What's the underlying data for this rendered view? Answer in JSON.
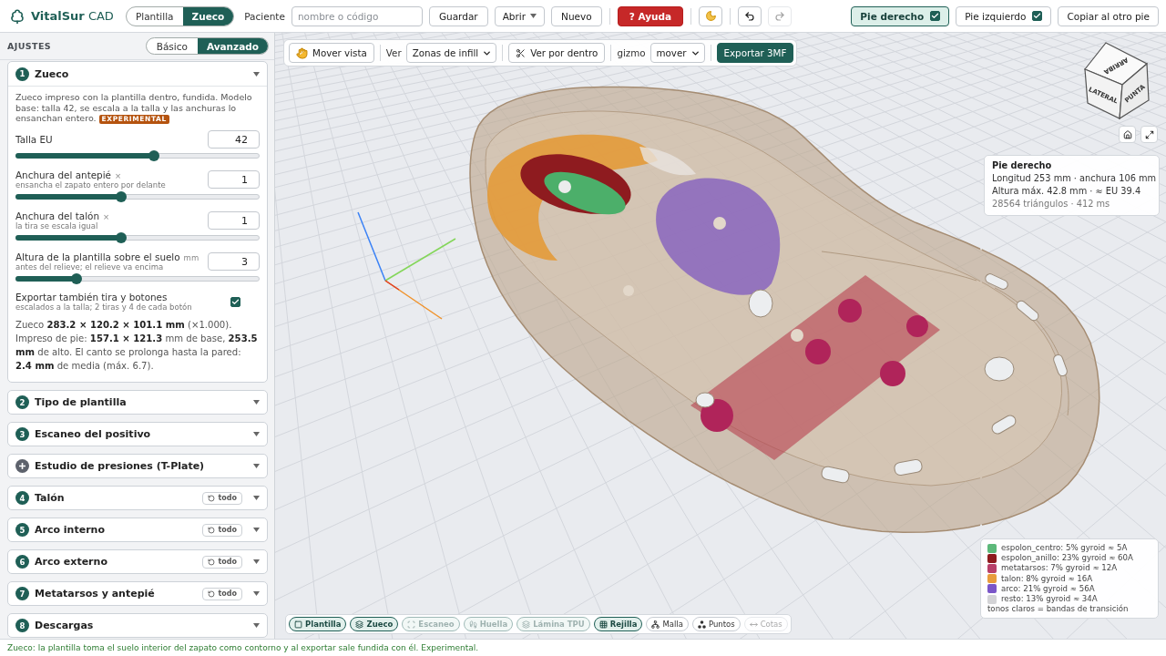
{
  "app_title": "**VitalSur** CAD",
  "mode_tabs": [
    {
      "label": "Plantilla",
      "selected": false
    },
    {
      "label": "Zueco",
      "selected": true
    }
  ],
  "patient": {
    "label": "Paciente",
    "placeholder": "nombre o código"
  },
  "file_buttons": [
    {
      "label": "Guardar",
      "kind": "plain"
    },
    {
      "label": "Abrir",
      "kind": "menu"
    },
    {
      "label": "Nuevo",
      "kind": "plain"
    }
  ],
  "help_button": "? Ayuda",
  "history": [
    {
      "disabled": false
    },
    {
      "disabled": true
    }
  ],
  "feet": [
    {
      "label": "Pie derecho",
      "selected": true,
      "checked": true
    },
    {
      "label": "Pie izquierdo",
      "selected": false,
      "checked": true
    }
  ],
  "copy_button": "Copiar al otro pie",
  "sidebar": {
    "title": "AJUSTES",
    "modes": [
      {
        "label": "Básico",
        "selected": false
      },
      {
        "label": "Avanzado",
        "selected": true
      }
    ],
    "sections": [
      {
        "kind": "numbered",
        "number": "1",
        "title": "Zueco",
        "expanded": true,
        "description": "Zueco impreso con la plantilla dentro, fundida. Modelo base: talla 42, se escala a la talla y las anchuras lo ensanchan entero.",
        "badge": "EXPERIMENTAL",
        "controls": [
          {
            "kind": "slider",
            "label": "Talla EU",
            "value": "42",
            "level": 0.57
          },
          {
            "kind": "slider",
            "label": "Anchura del antepié",
            "unit": "×",
            "hint": "ensancha el zapato entero por delante",
            "value": "1",
            "level": 0.43
          },
          {
            "kind": "slider",
            "label": "Anchura del talón",
            "unit": "×",
            "hint": "la tira se escala igual",
            "value": "1",
            "level": 0.43
          },
          {
            "kind": "slider",
            "label": "Altura de la plantilla sobre el suelo",
            "unit": "mm",
            "hint": "antes del relieve; el relieve va encima",
            "value": "3",
            "level": 0.24
          },
          {
            "kind": "checkbox",
            "label": "Exportar también tira y botones",
            "hint": "escalados a la talla; 2 tiras y 4 de cada botón",
            "checked": true
          }
        ],
        "summary": "Zueco **283.2 × 120.2 × 101.1 mm** (×1.000). Impreso de pie: **157.1 × 121.3** mm de base, **253.5 mm** de alto. El canto se prolonga hasta la pared: **2.4 mm** de media (máx. 6.7)."
      },
      {
        "kind": "numbered",
        "number": "2",
        "title": "Tipo de plantilla",
        "expanded": false
      },
      {
        "kind": "numbered",
        "number": "3",
        "title": "Escaneo del positivo",
        "expanded": false
      },
      {
        "kind": "optional",
        "title": "Estudio de presiones (T-Plate)",
        "expanded": false
      },
      {
        "kind": "numbered",
        "number": "4",
        "title": "Talón",
        "expanded": false,
        "reset": "todo"
      },
      {
        "kind": "numbered",
        "number": "5",
        "title": "Arco interno",
        "expanded": false,
        "reset": "todo"
      },
      {
        "kind": "numbered",
        "number": "6",
        "title": "Arco externo",
        "expanded": false,
        "reset": "todo"
      },
      {
        "kind": "numbered",
        "number": "7",
        "title": "Metatarsos y antepié",
        "expanded": false,
        "reset": "todo"
      },
      {
        "kind": "numbered",
        "number": "8",
        "title": "Descargas",
        "expanded": false
      }
    ]
  },
  "viewport": {
    "toolbar": {
      "pan_button": "Mover vista",
      "view_label": "Ver",
      "view_select": "Zonas de infill",
      "section_button": "Ver por dentro",
      "gizmo_label": "gizmo",
      "gizmo_select": "mover",
      "export_button": "Exportar 3MF"
    },
    "view_cube": {
      "faces": [
        "ARRIBA",
        "LATERAL",
        "PUNTA"
      ]
    },
    "info": {
      "title": "Pie derecho",
      "lines": [
        "Longitud 253 mm · anchura 106 mm",
        "Altura máx. 42.8 mm · ≈ EU 39.4"
      ],
      "meta": "28564 triángulos · 412 ms"
    },
    "legend": {
      "items": [
        {
          "label": "espolon_centro: 5% gyroid ≈ 5A",
          "color": "#5cb87a"
        },
        {
          "label": "espolon_anillo: 23% gyroid ≈ 60A",
          "color": "#8e1b1f"
        },
        {
          "label": "metatarsos: 7% gyroid ≈ 12A",
          "color": "#b8406a"
        },
        {
          "label": "talon: 8% gyroid ≈ 16A",
          "color": "#e89c3c"
        },
        {
          "label": "arco: 21% gyroid ≈ 56A",
          "color": "#7a56c8"
        },
        {
          "label": "resto: 13% gyroid ≈ 34A",
          "color": "#d3d3d6"
        }
      ],
      "note": "tonos claros = bandas de transición"
    },
    "layers": [
      {
        "label": "Plantilla",
        "on": true,
        "disabled": false
      },
      {
        "label": "Zueco",
        "on": true,
        "disabled": false
      },
      {
        "label": "Escaneo",
        "on": true,
        "disabled": true
      },
      {
        "label": "Huella",
        "on": true,
        "disabled": true
      },
      {
        "label": "Lámina TPU",
        "on": true,
        "disabled": true
      },
      {
        "label": "Rejilla",
        "on": true,
        "disabled": false
      },
      {
        "label": "Malla",
        "on": false,
        "disabled": false
      },
      {
        "label": "Puntos",
        "on": false,
        "disabled": false
      },
      {
        "label": "Cotas",
        "on": false,
        "disabled": true
      }
    ]
  },
  "status_bar": "Zueco: la plantilla toma el suelo interior del zapato como contorno y al exportar sale fundida con él. Experimental."
}
